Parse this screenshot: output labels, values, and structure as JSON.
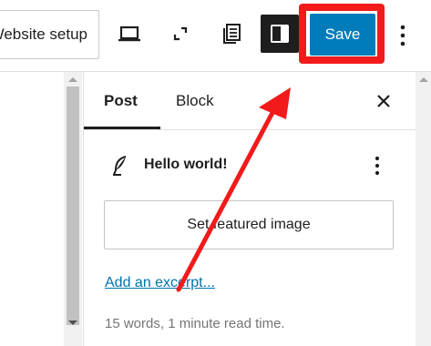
{
  "toolbar": {
    "site_setup_label": "Website setup",
    "icons": {
      "preview": "laptop-icon",
      "fullscreen": "fullscreen-icon",
      "outline": "document-outline-icon",
      "settings": "sidebar-toggle-icon",
      "more": "more-vertical-icon"
    },
    "save_label": "Save"
  },
  "sidebar": {
    "tabs": [
      {
        "label": "Post",
        "active": true
      },
      {
        "label": "Block",
        "active": false
      }
    ],
    "post": {
      "icon": "feather-icon",
      "title": "Hello world!"
    },
    "featured_image_label": "Set featured image",
    "excerpt_link": "Add an excerpt...",
    "read_time": "15 words, 1 minute read time."
  },
  "colors": {
    "accent": "#007cba",
    "highlight": "#f21a1a",
    "link": "#0073aa"
  }
}
